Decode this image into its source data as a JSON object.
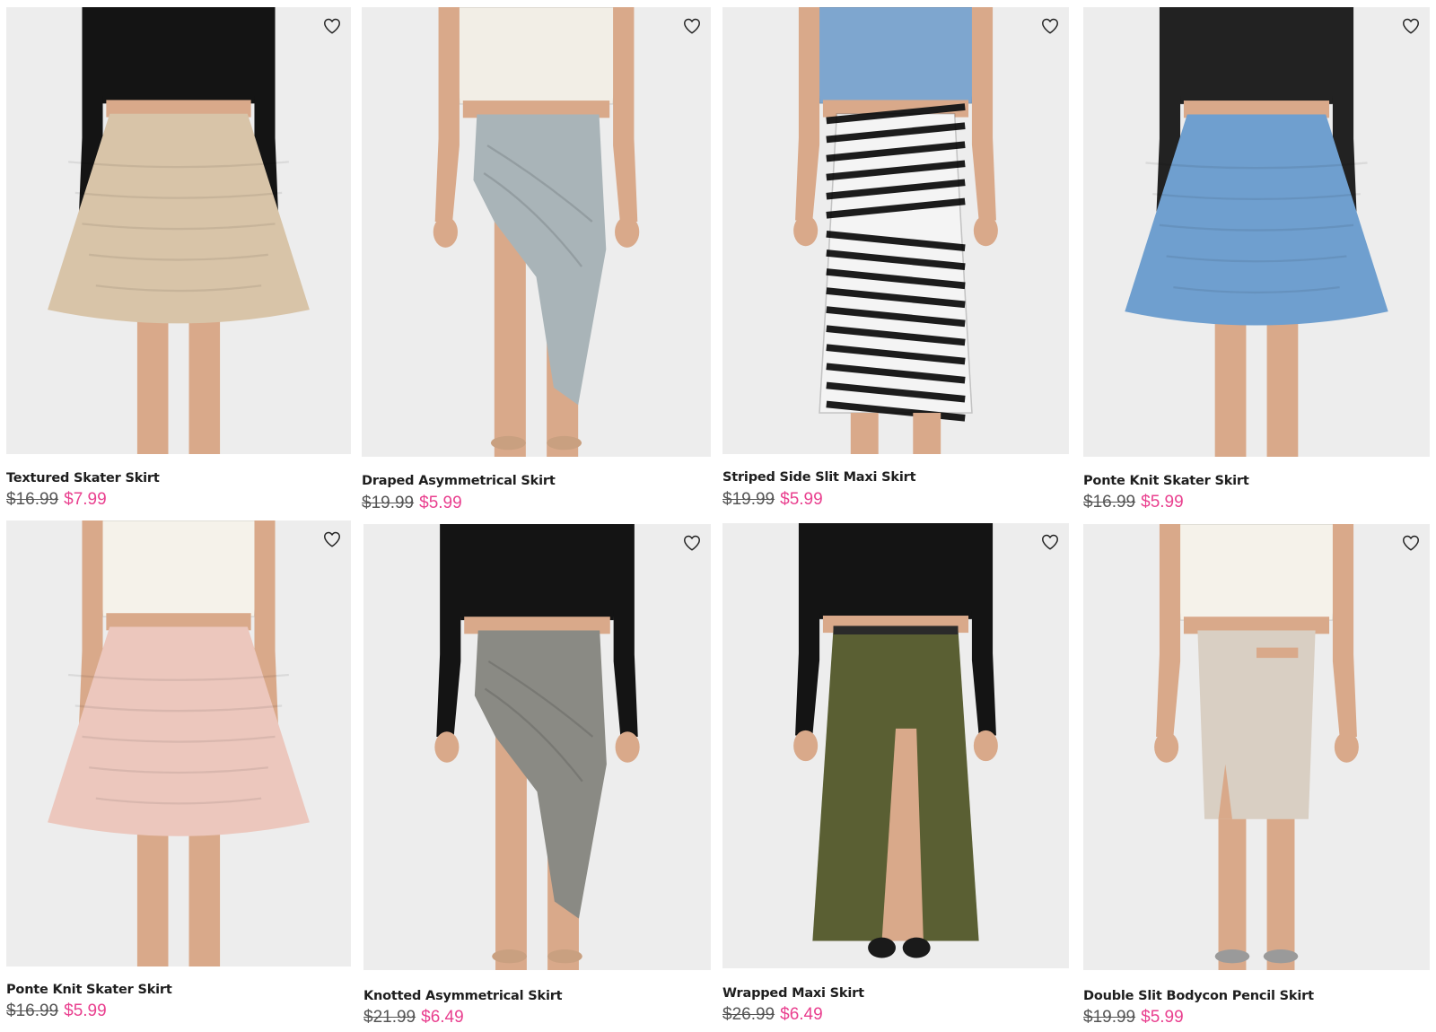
{
  "colors": {
    "sale_price": "#e9408f",
    "original_price": "#555555",
    "product_name": "#1e1e1e",
    "photo_background": "#ececec"
  },
  "products": [
    {
      "name": "Textured Skater Skirt",
      "original_price": "$16.99",
      "sale_price": "$7.99",
      "skirt_color": "#d8c4a8",
      "top_color": "#141414",
      "style": "skater",
      "wishlist_icon": "heart-outline-icon"
    },
    {
      "name": "Draped Asymmetrical Skirt",
      "original_price": "$19.99",
      "sale_price": "$5.99",
      "skirt_color": "#a9b4b8",
      "top_color": "#f2eee6",
      "style": "asymmetric",
      "wishlist_icon": "heart-outline-icon"
    },
    {
      "name": "Striped Side Slit Maxi Skirt",
      "original_price": "$19.99",
      "sale_price": "$5.99",
      "skirt_color": "#1c1c1c",
      "top_color": "#7ea6cf",
      "style": "stripe-maxi",
      "wishlist_icon": "heart-outline-icon"
    },
    {
      "name": "Ponte Knit Skater Skirt",
      "original_price": "$16.99",
      "sale_price": "$5.99",
      "skirt_color": "#6f9fcf",
      "top_color": "#222222",
      "style": "skater",
      "wishlist_icon": "heart-outline-icon"
    },
    {
      "name": "Ponte Knit Skater Skirt",
      "original_price": "$16.99",
      "sale_price": "$5.99",
      "skirt_color": "#ecc7bd",
      "top_color": "#f5f2ea",
      "style": "skater",
      "wishlist_icon": "heart-outline-icon"
    },
    {
      "name": "Knotted Asymmetrical Skirt",
      "original_price": "$21.99",
      "sale_price": "$6.49",
      "skirt_color": "#8a8a84",
      "top_color": "#141414",
      "style": "asymmetric",
      "wishlist_icon": "heart-outline-icon"
    },
    {
      "name": "Wrapped Maxi Skirt",
      "original_price": "$26.99",
      "sale_price": "$6.49",
      "skirt_color": "#5a5f33",
      "top_color": "#141414",
      "style": "slit-maxi",
      "wishlist_icon": "heart-outline-icon"
    },
    {
      "name": "Double Slit Bodycon Pencil Skirt",
      "original_price": "$19.99",
      "sale_price": "$5.99",
      "skirt_color": "#d9cfc3",
      "top_color": "#f5f2ea",
      "style": "pencil",
      "wishlist_icon": "heart-outline-icon"
    }
  ]
}
